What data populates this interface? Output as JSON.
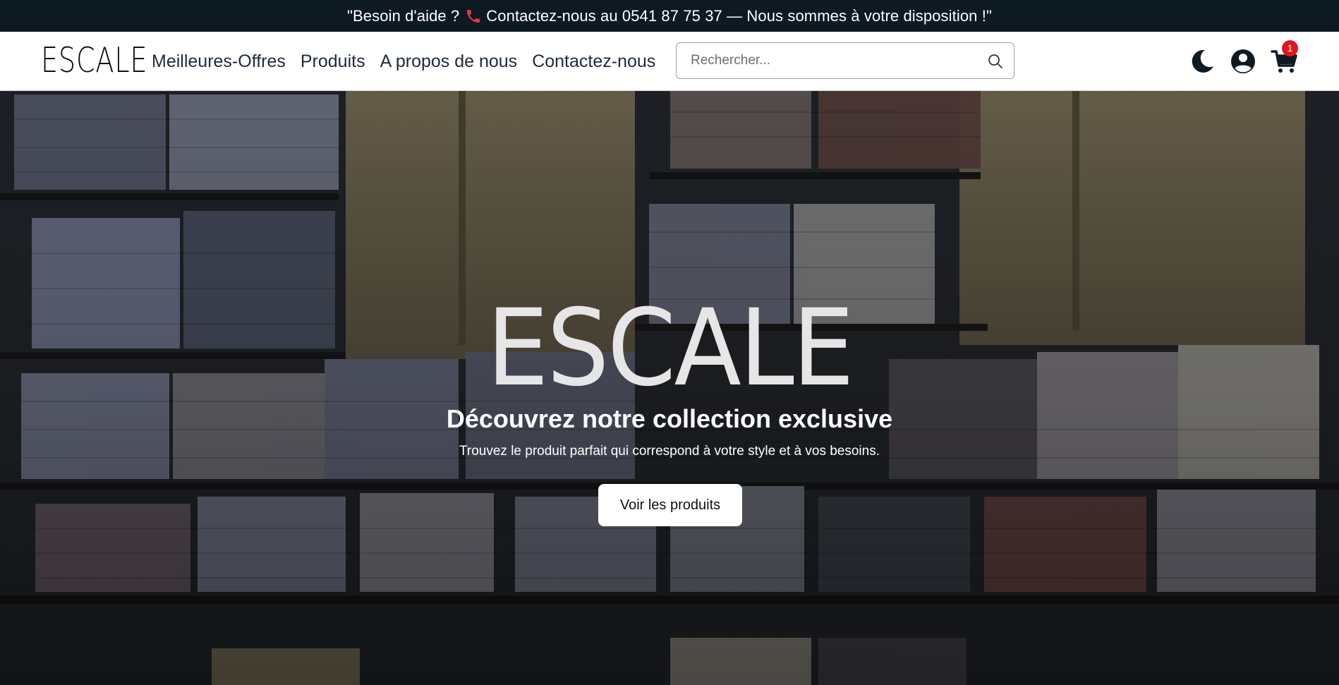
{
  "topbar": {
    "text_before": "\"Besoin d'aide ?",
    "text_after": "Contactez-nous au 0541 87 75 37 — Nous sommes à votre disposition !\"",
    "icon": "phone-icon",
    "icon_color": "#e53935"
  },
  "navbar": {
    "logo": "ESCALE",
    "links": [
      {
        "label": "Meilleures-Offres"
      },
      {
        "label": "Produits"
      },
      {
        "label": "A propos de nous"
      },
      {
        "label": "Contactez-nous"
      }
    ],
    "search": {
      "placeholder": "Rechercher...",
      "value": "",
      "icon": "search-icon"
    },
    "icons": [
      "moon-icon",
      "user-icon",
      "cart-icon"
    ],
    "cart_count": "1",
    "badge_color": "#e0161c"
  },
  "hero": {
    "title": "ESCALE",
    "subtitle": "Découvrez notre collection exclusive",
    "text": "Trouvez le produit parfait qui correspond à votre style et à vos besoins.",
    "button_label": "Voir les produits"
  },
  "colors": {
    "topbar_bg": "#0e1a22",
    "text_dark": "#1f2a3c",
    "accent_red": "#e0161c"
  }
}
